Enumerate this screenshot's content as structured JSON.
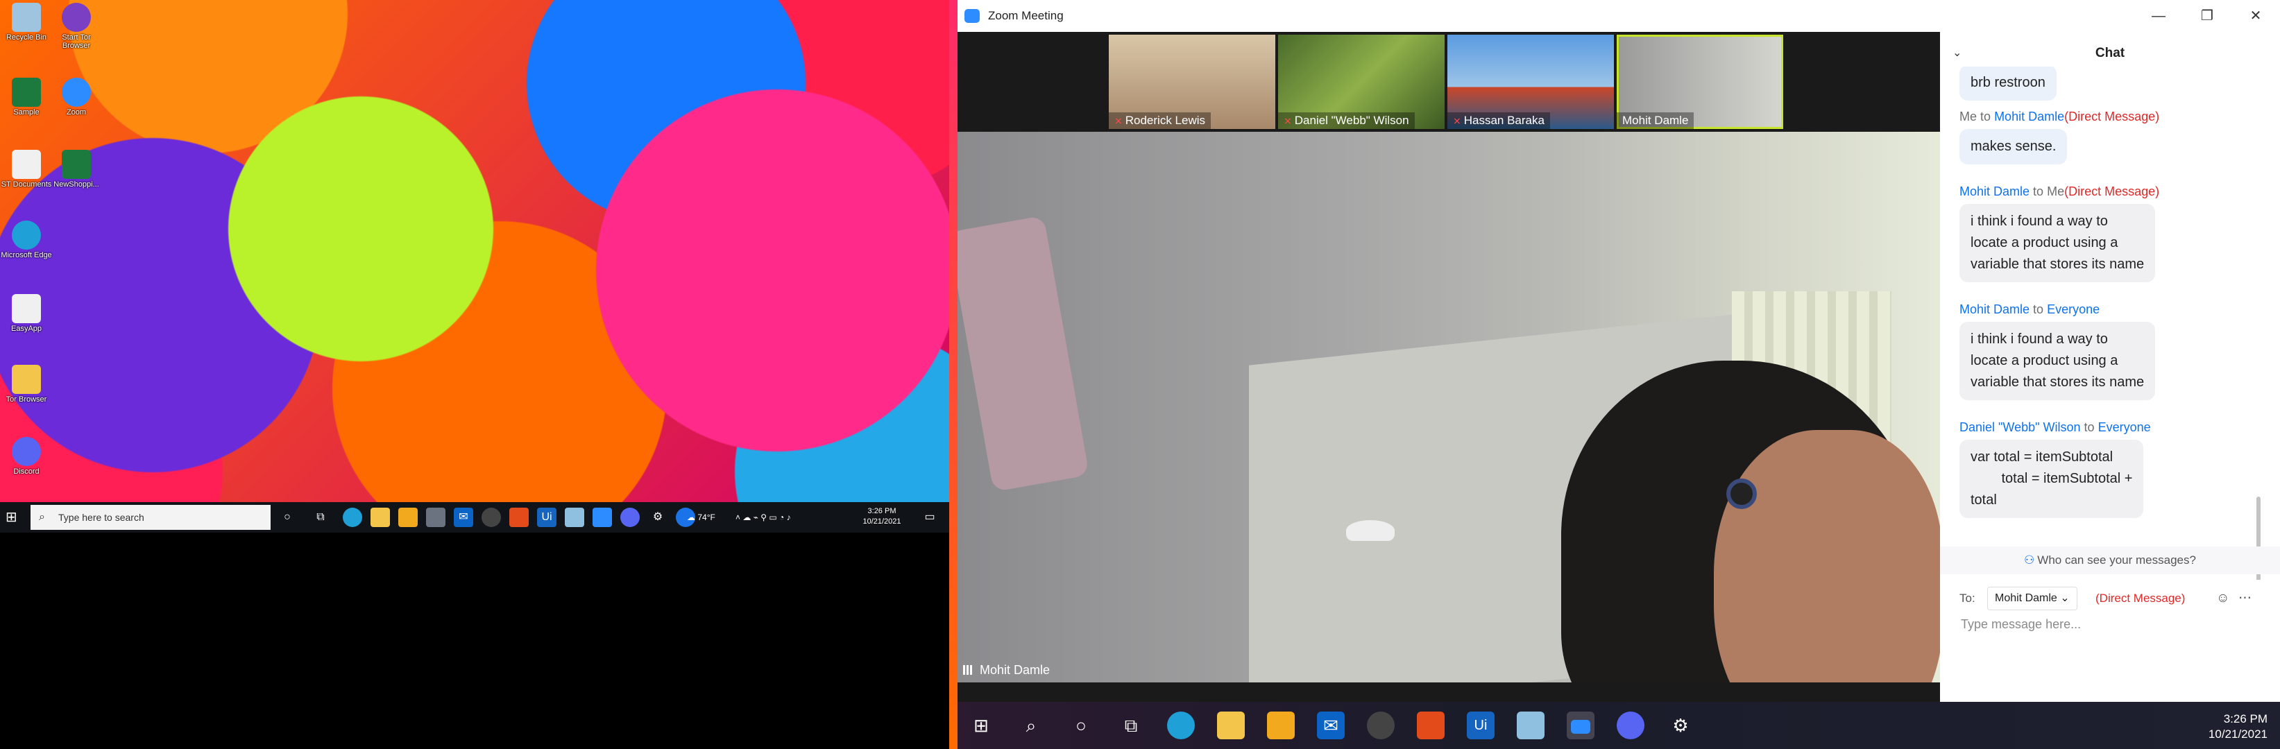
{
  "desktop_icons": [
    {
      "label": "Recycle Bin",
      "color": "#9ec4e0"
    },
    {
      "label": "Start Tor Browser",
      "color": "#7a3fc2"
    },
    {
      "label": "Sample",
      "color": "#1d7a3e"
    },
    {
      "label": "Zoom",
      "color": "#2d8cff"
    },
    {
      "label": "ST Documents",
      "color": "#f0f0f0"
    },
    {
      "label": "NewShoppi...",
      "color": "#1d7a3e"
    },
    {
      "label": "Microsoft Edge",
      "color": "#1fa0d6"
    },
    {
      "label": "EasyApp",
      "color": "#f0f0f0"
    },
    {
      "label": "Tor Browser",
      "color": "#f3c64b"
    },
    {
      "label": "Discord",
      "color": "#5865f2"
    }
  ],
  "left_taskbar": {
    "search_placeholder": "Type here to search",
    "weather": "74°F",
    "time": "3:26 PM",
    "date": "10/21/2021"
  },
  "zoom": {
    "title": "Zoom Meeting",
    "participants": [
      {
        "name": "Roderick Lewis",
        "muted": true
      },
      {
        "name": "Daniel \"Webb\" Wilson",
        "muted": true
      },
      {
        "name": "Hassan Baraka",
        "muted": true
      },
      {
        "name": "Mohit Damle",
        "muted": false
      }
    ],
    "active_speaker": "Mohit Damle"
  },
  "chat": {
    "title": "Chat",
    "messages": [
      {
        "text": "brb restroon"
      },
      {
        "from": "Me",
        "to_word": "to",
        "to": "Mohit Damle",
        "dm": "(Direct Message)",
        "text": "makes sense."
      },
      {
        "from": "Mohit Damle",
        "to_word": "to",
        "to": "Me",
        "dm": "(Direct Message)",
        "text": "i think i found a way to\nlocate a product using a\nvariable that stores its name"
      },
      {
        "from": "Mohit Damle",
        "to_word": "to",
        "to": "Everyone",
        "text": "i think i found a way to\nlocate a product using a\nvariable that stores its name"
      },
      {
        "from": "Daniel \"Webb\" Wilson",
        "to_word": "to",
        "to": "Everyone",
        "text": "var total = itemSubtotal\n        total = itemSubtotal +\ntotal"
      }
    ],
    "who_can_see": "Who can see your messages?",
    "to_label": "To:",
    "to_value": "Mohit Damle",
    "to_dm": "(Direct Message)",
    "input_placeholder": "Type message here..."
  },
  "right_taskbar": {
    "time": "3:26 PM",
    "date": "10/21/2021"
  }
}
